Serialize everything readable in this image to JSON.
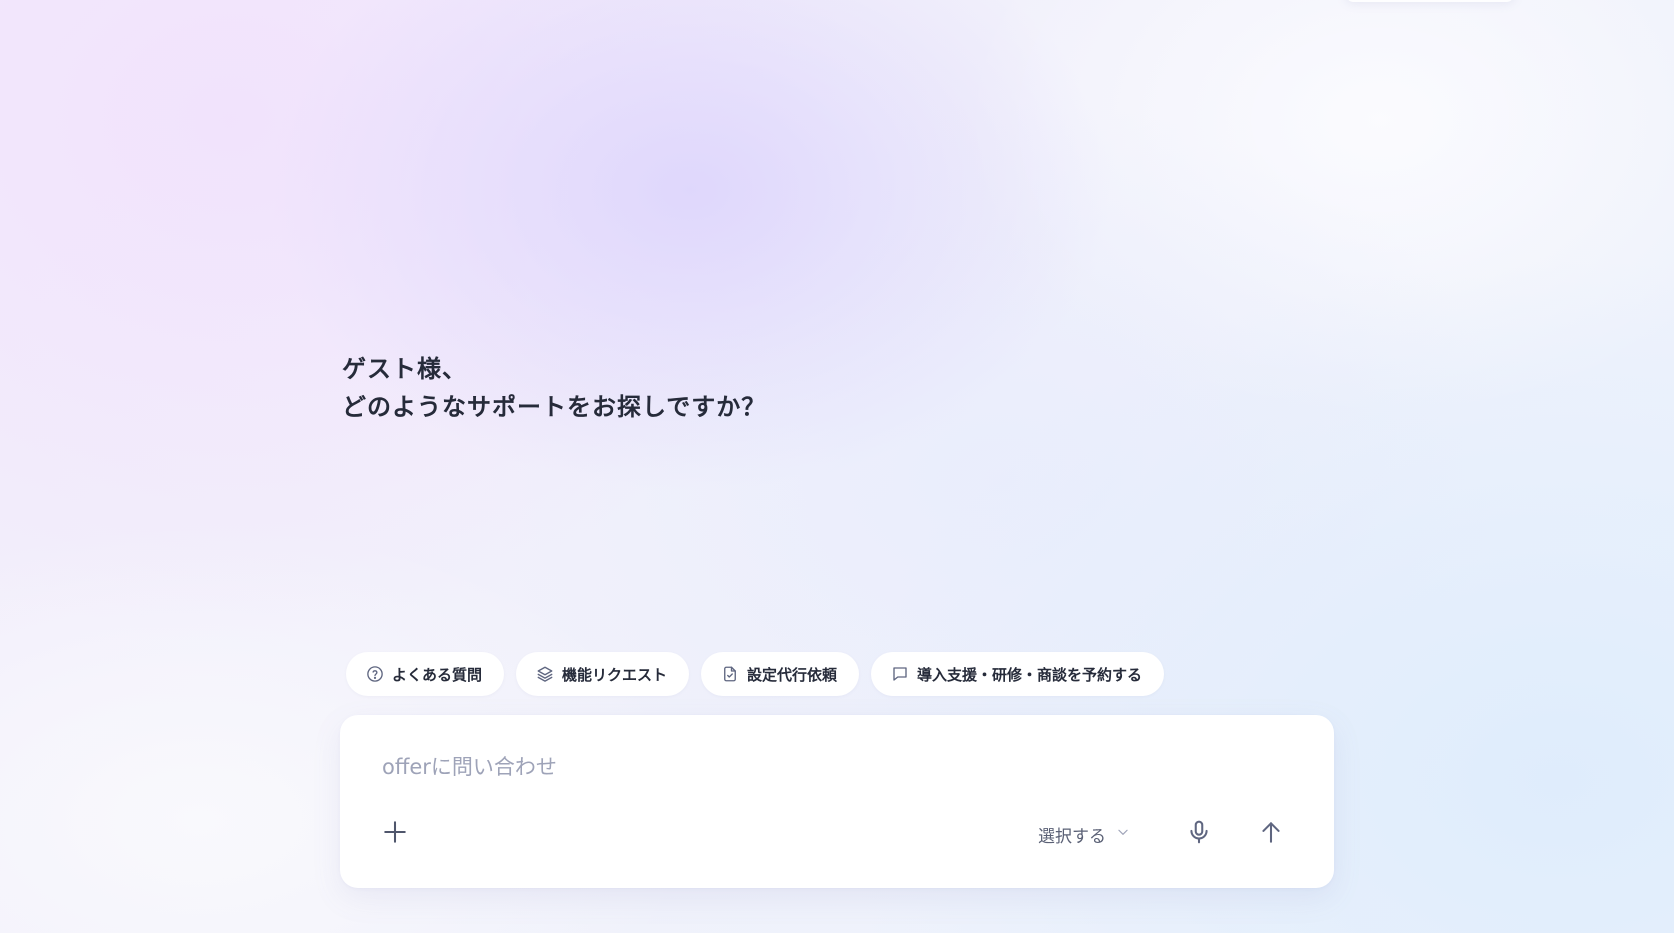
{
  "greeting": {
    "line1": "ゲスト様、",
    "line2": "どのようなサポートをお探しですか？"
  },
  "quick_actions": [
    {
      "label": "よくある質問",
      "icon": "question-circle-icon"
    },
    {
      "label": "機能リクエスト",
      "icon": "layers-icon"
    },
    {
      "label": "設定代行依頼",
      "icon": "document-check-icon"
    },
    {
      "label": "導入支援・研修・商談を予約する",
      "icon": "chat-bubble-icon"
    }
  ],
  "composer": {
    "placeholder": "offerに問い合わせ",
    "value": "",
    "attach_icon": "plus-icon",
    "select_label": "選択する",
    "select_icon": "chevron-down-icon",
    "mic_icon": "microphone-icon",
    "send_icon": "arrow-up-icon"
  },
  "colors": {
    "text": "#262b3a",
    "icon": "#5f6680",
    "placeholder": "#9ea3b8",
    "card": "#ffffff"
  }
}
